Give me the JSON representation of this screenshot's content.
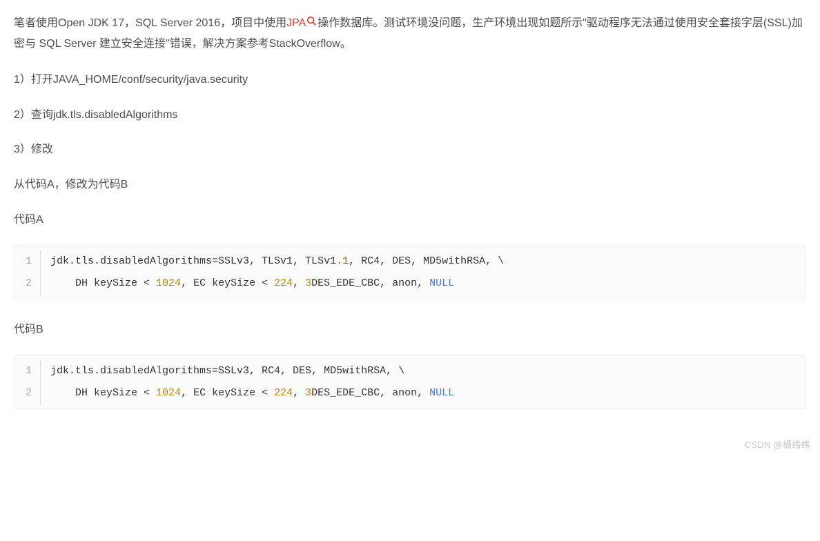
{
  "intro": {
    "part1": "笔者使用Open JDK 17，SQL Server 2016，项目中使用",
    "jpa": "JPA",
    "part2": "操作数据库。测试环境没问题，生产环境出现如题所示\"驱动程序无法通过使用安全套接字层(SSL)加密与 SQL Server 建立安全连接\"错误，解决方案参考StackOverflow。"
  },
  "steps": {
    "s1": "1）打开JAVA_HOME/conf/security/java.security",
    "s2": "2）查询jdk.tls.disabledAlgorithms",
    "s3": "3）修改"
  },
  "change_note": "从代码A，修改为代码B",
  "labels": {
    "codeA": "代码A",
    "codeB": "代码B"
  },
  "codeA": {
    "line1": {
      "prefix": "jdk.tls.disabledAlgorithms=SSLv3, TLSv1, TLSv1",
      "float": ".1",
      "suffix": ", RC4, DES, MD5withRSA, \\"
    },
    "line2": {
      "indent": "    ",
      "p1": "DH keySize < ",
      "n1": "1024",
      "p2": ", EC keySize < ",
      "n2": "224",
      "p3": ", ",
      "n3": "3",
      "p4": "DES_EDE_CBC, anon, ",
      "null": "NULL"
    }
  },
  "codeB": {
    "line1": "jdk.tls.disabledAlgorithms=SSLv3, RC4, DES, MD5withRSA, \\",
    "line2": {
      "indent": "    ",
      "p1": "DH keySize < ",
      "n1": "1024",
      "p2": ", EC keySize < ",
      "n2": "224",
      "p3": ", ",
      "n3": "3",
      "p4": "DES_EDE_CBC, anon, ",
      "null": "NULL"
    }
  },
  "line_numbers": {
    "one": "1",
    "two": "2"
  },
  "watermark": "CSDN @橘络络"
}
